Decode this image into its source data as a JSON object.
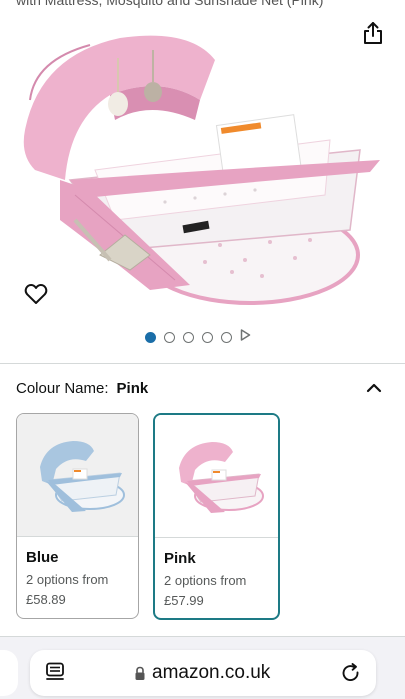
{
  "product": {
    "title_fragment": "with Mattress, Mosquito and Sunshade Net (Pink)"
  },
  "gallery": {
    "image_count": 5,
    "active_index": 0,
    "has_video": true
  },
  "colour": {
    "label": "Colour Name:",
    "selected": "Pink"
  },
  "swatches": [
    {
      "name": "Blue",
      "options": "2 options from",
      "price": "£58.89",
      "selected": false
    },
    {
      "name": "Pink",
      "options": "2 options from",
      "price": "£57.99",
      "selected": true
    }
  ],
  "browser": {
    "url": "amazon.co.uk"
  },
  "colors": {
    "accent": "#1d7a85",
    "pager_active": "#1b6ea8",
    "product_pink": "#e7a3c2",
    "product_blue": "#9fbfdc"
  }
}
